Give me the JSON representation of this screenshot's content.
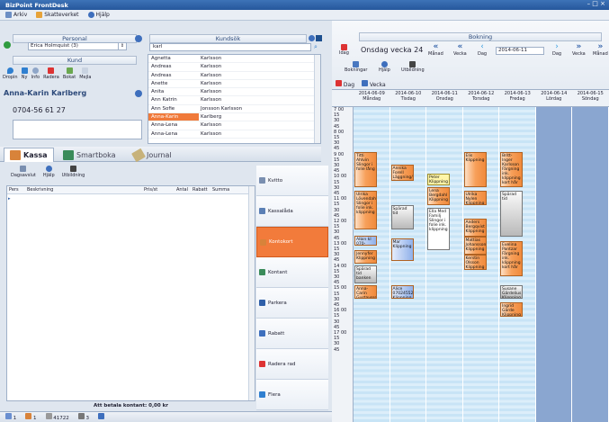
{
  "window": {
    "title": "BizPoint FrontDesk",
    "controls": "– □ ×"
  },
  "menu": [
    "Arkiv",
    "Skatteverket",
    "Hjälp"
  ],
  "personal": {
    "header": "Personal",
    "selected": "Erica Holmquist (3)"
  },
  "kund": {
    "header": "Kund",
    "toolbar": [
      "Dropin",
      "Ny",
      "Info",
      "Radera",
      "Bokat",
      "Mejla"
    ],
    "name": "Anna-Karin Karlberg",
    "phone": "0704-56 61 27"
  },
  "kundsok": {
    "header": "Kundsök",
    "query": "karl",
    "rows": [
      [
        "Agnetta",
        "Karlsson"
      ],
      [
        "Andreas",
        "Karlsson"
      ],
      [
        "Andreas",
        "Karlsson"
      ],
      [
        "Anette",
        "Karlsson"
      ],
      [
        "Anita",
        "Karlsson"
      ],
      [
        "Ann Katrin",
        "Karlsson"
      ],
      [
        "Ann Sofie",
        "Jonsson Karlsson"
      ],
      [
        "Anna-Karin",
        "Karlberg"
      ],
      [
        "Anna-Lena",
        "Karlsson"
      ],
      [
        "Anna-Lena",
        "Karlsson"
      ]
    ],
    "selected_index": 7
  },
  "tabs": [
    "Kassa",
    "Smartboka",
    "Journal"
  ],
  "kassa": {
    "toolbar": [
      "Dagsavslut",
      "Hjälp",
      "Utbildning"
    ],
    "columns": [
      "Pers",
      "Beskrivning",
      "Pris/st",
      "Antal",
      "Rabatt",
      "Summa"
    ],
    "total": "Att betala kontant: 0,00 kr"
  },
  "side_buttons": [
    "Kvitto",
    "Kassalåda",
    "Kontokort",
    "Kontant",
    "Parkera",
    "Rabatt",
    "Radera rad",
    "Flera"
  ],
  "side_active": 2,
  "status": {
    "items": [
      "1",
      "1",
      "41722",
      "3"
    ]
  },
  "bokning": {
    "header": "Bokning",
    "today": "Idag",
    "week_label": "Onsdag vecka 24",
    "nav": [
      "Månad",
      "Vecka",
      "Dag"
    ],
    "date": "2014-06-11",
    "nav2": [
      "Dag",
      "Vecka",
      "Månad"
    ],
    "toolbar2": [
      "Bokningar",
      "Hjälp",
      "Utbildning"
    ],
    "view_tabs": [
      "Dag",
      "Vecka"
    ]
  },
  "days": [
    {
      "date": "2014-06-09",
      "name": "Måndag"
    },
    {
      "date": "2014-06-10",
      "name": "Tisdag"
    },
    {
      "date": "2014-06-11",
      "name": "Onsdag"
    },
    {
      "date": "2014-06-12",
      "name": "Torsdag"
    },
    {
      "date": "2014-06-13",
      "name": "Fredag"
    },
    {
      "date": "2014-06-14",
      "name": "Lördag"
    },
    {
      "date": "2014-06-15",
      "name": "Söndag"
    }
  ],
  "times": [
    "7 00",
    "15",
    "30",
    "45",
    "8 00",
    "15",
    "30",
    "45",
    "9 00",
    "15",
    "30",
    "45",
    "10 00",
    "15",
    "30",
    "45",
    "11 00",
    "15",
    "30",
    "45",
    "12 00",
    "15",
    "30",
    "45",
    "13 00",
    "15",
    "30",
    "45",
    "14 00",
    "15",
    "30",
    "45",
    "15 00",
    "15",
    "30",
    "45",
    "16 00",
    "15",
    "30",
    "45",
    "17 00",
    "15",
    "30",
    "45"
  ],
  "events": [
    {
      "day": 0,
      "start": 9.0,
      "end": 10.6,
      "text": "Titti Ahlvin Slingor i folie lång",
      "kind": "o"
    },
    {
      "day": 0,
      "start": 10.75,
      "end": 12.5,
      "text": "Ulrika Lövendahl Slingor i folie ink. klippning",
      "kind": "o"
    },
    {
      "day": 0,
      "start": 12.75,
      "end": 13.2,
      "text": "Albin kl 070-791066",
      "kind": "b"
    },
    {
      "day": 0,
      "start": 13.4,
      "end": 14.0,
      "text": "Jennyfer Klippning",
      "kind": "o"
    },
    {
      "day": 0,
      "start": 14.1,
      "end": 14.9,
      "text": "Spärad tid banken",
      "kind": "g"
    },
    {
      "day": 0,
      "start": 15.0,
      "end": 15.6,
      "text": "Anna-Carin Gustavsson Klippning",
      "kind": "o"
    },
    {
      "day": 1,
      "start": 9.6,
      "end": 10.3,
      "text": "Annika Forell Läggning/Styling Kort",
      "kind": "o"
    },
    {
      "day": 1,
      "start": 11.4,
      "end": 12.5,
      "text": "Spärad tid",
      "kind": "g"
    },
    {
      "day": 1,
      "start": 12.9,
      "end": 13.9,
      "text": "Mar Klippning",
      "kind": "b"
    },
    {
      "day": 1,
      "start": 15.0,
      "end": 15.6,
      "text": "Alice 070245525 Klippning",
      "kind": "b"
    },
    {
      "day": 2,
      "start": 10.0,
      "end": 10.5,
      "text": "Peter Klippning",
      "kind": "y"
    },
    {
      "day": 2,
      "start": 10.6,
      "end": 11.4,
      "text": "Lena Bergdahl Klippning",
      "kind": "o"
    },
    {
      "day": 2,
      "start": 11.5,
      "end": 13.4,
      "text": "Ella Med Familj Slingor i folie ink. klippning",
      "kind": "w"
    },
    {
      "day": 3,
      "start": 9.0,
      "end": 10.6,
      "text": "Elis Klippning",
      "kind": "o"
    },
    {
      "day": 3,
      "start": 10.75,
      "end": 11.4,
      "text": "Ulrika Nylen Klippning",
      "kind": "o"
    },
    {
      "day": 3,
      "start": 12.0,
      "end": 12.8,
      "text": "Anders Bergqvist Klippning",
      "kind": "o"
    },
    {
      "day": 3,
      "start": 12.8,
      "end": 13.6,
      "text": "Mattias Johansson Klippning",
      "kind": "o"
    },
    {
      "day": 3,
      "start": 13.6,
      "end": 14.3,
      "text": "Kerstin Olsson Klippning",
      "kind": "o"
    },
    {
      "day": 4,
      "start": 9.0,
      "end": 10.6,
      "text": "Britt-Inger Karlsson Färgning ink. klippning kort hår",
      "kind": "o"
    },
    {
      "day": 4,
      "start": 10.75,
      "end": 12.8,
      "text": "Spärad tid",
      "kind": "g"
    },
    {
      "day": 4,
      "start": 13.0,
      "end": 14.6,
      "text": "Evelina Pantzar Färgning ink. klippning kort hår",
      "kind": "o"
    },
    {
      "day": 4,
      "start": 15.0,
      "end": 15.6,
      "text": "Susane Gärdelius Klippning",
      "kind": "g"
    },
    {
      "day": 4,
      "start": 15.75,
      "end": 16.4,
      "text": "Ingrid Gärde Klippning",
      "kind": "o"
    }
  ]
}
